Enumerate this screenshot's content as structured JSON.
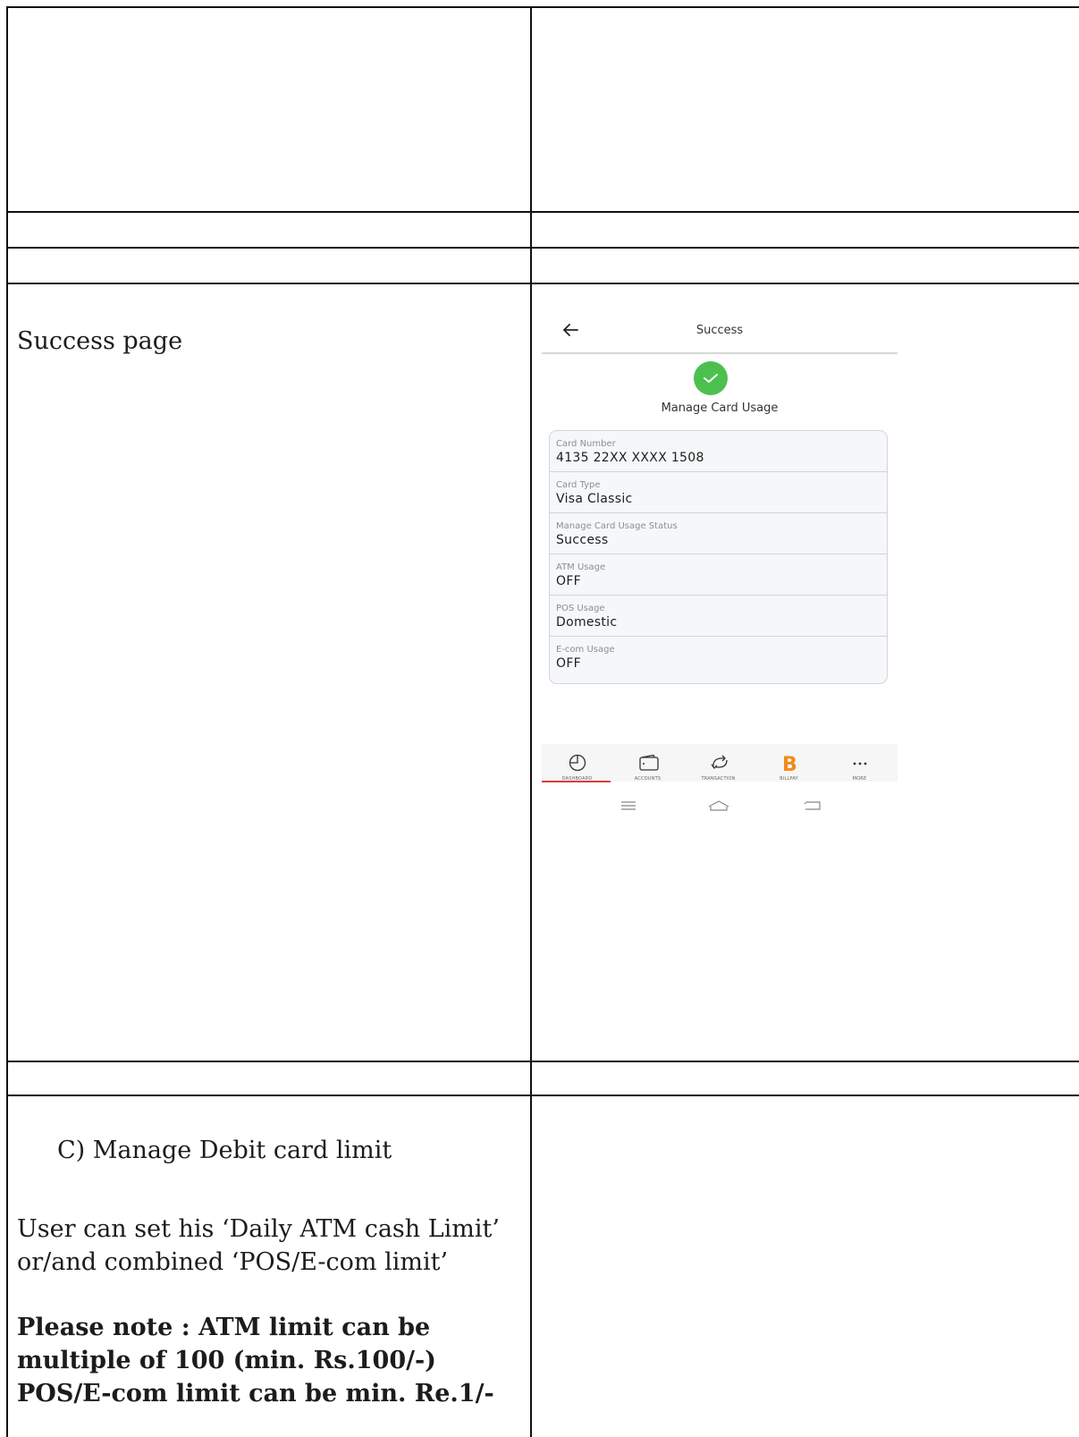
{
  "row_success": {
    "label": "Success page"
  },
  "phone": {
    "header_title": "Success",
    "subtitle": "Manage Card Usage",
    "fields": [
      {
        "label": "Card Number",
        "value": "4135 22XX XXXX 1508"
      },
      {
        "label": "Card Type",
        "value": "Visa Classic"
      },
      {
        "label": "Manage Card Usage Status",
        "value": "Success"
      },
      {
        "label": "ATM Usage",
        "value": "OFF"
      },
      {
        "label": "POS Usage",
        "value": "Domestic"
      },
      {
        "label": "E-com Usage",
        "value": "OFF"
      }
    ],
    "nav": [
      {
        "label": "DASHBOARD",
        "icon": "pie-chart-icon"
      },
      {
        "label": "ACCOUNTS",
        "icon": "wallet-icon"
      },
      {
        "label": "TRANSACTION",
        "icon": "transfer-arrows-icon"
      },
      {
        "label": "BILLPAY",
        "icon": "billpay-b-icon"
      },
      {
        "label": "MORE",
        "icon": "more-dots-icon"
      }
    ],
    "colors": {
      "success_green": "#4cc04f",
      "billpay_orange": "#f28a1c",
      "active_red": "#e03a3a"
    }
  },
  "row_limit": {
    "heading": "C)  Manage Debit card limit",
    "description": "User can set his ‘Daily ATM cash Limit’ or/and combined ‘POS/E-com limit’",
    "note_line1": "Please note : ATM limit can be",
    "note_line2": "multiple of 100 (min. Rs.100/-)",
    "note_line3": "POS/E-com limit can be min. Re.1/-"
  }
}
